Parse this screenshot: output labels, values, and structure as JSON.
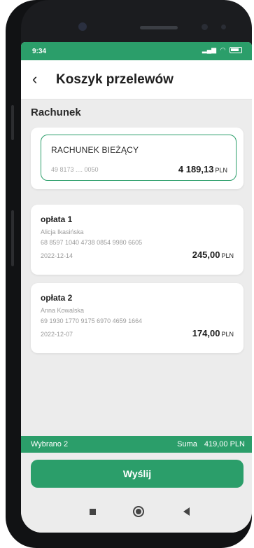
{
  "status_bar": {
    "time": "9:34",
    "signal_text": "ᵢₗₗ",
    "wifi_glyph": "◠"
  },
  "header": {
    "title": "Koszyk przelewów",
    "back_icon": "chevron-left-icon"
  },
  "section": {
    "label": "Rachunek"
  },
  "account": {
    "name": "RACHUNEK BIEŻĄCY",
    "number": "49 8173 .... 0050",
    "balance_main": "4 189,13",
    "currency": "PLN"
  },
  "transfers": [
    {
      "title": "opłata 1",
      "recipient": "Alicja Ikasińska",
      "account": "68 8597 1040 4738 0854 9980 6605",
      "date": "2022-12-14",
      "amount": "245,00",
      "currency": "PLN"
    },
    {
      "title": "opłata 2",
      "recipient": "Anna Kowalska",
      "account": "69 1930 1770 9175 6970 4659 1664",
      "date": "2022-12-07",
      "amount": "174,00",
      "currency": "PLN"
    }
  ],
  "summary": {
    "selected": "Wybrano 2",
    "sum_label": "Suma",
    "sum_value": "419,00 PLN"
  },
  "actions": {
    "send_label": "Wyślij"
  },
  "colors": {
    "accent": "#2b9e6a",
    "background": "#ececec"
  }
}
